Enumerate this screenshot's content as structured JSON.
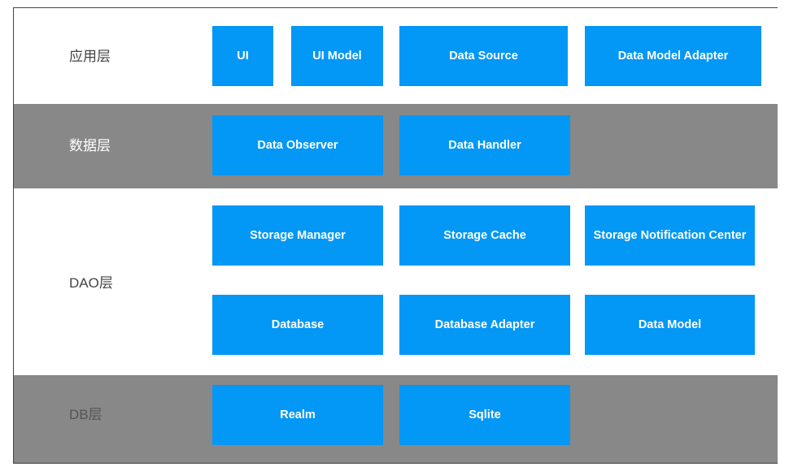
{
  "colors": {
    "box": "#0397f6",
    "gray_band": "#888888",
    "white_band": "#ffffff"
  },
  "layers": [
    {
      "label": "应用层",
      "boxes": [
        "UI",
        "UI Model",
        "Data Source",
        "Data Model Adapter"
      ]
    },
    {
      "label": "数据层",
      "boxes": [
        "Data Observer",
        "Data Handler"
      ]
    },
    {
      "label": "DAO层",
      "boxes": [
        "Storage Manager",
        "Storage Cache",
        "Storage Notification Center",
        "Database",
        "Database Adapter",
        "Data Model"
      ]
    },
    {
      "label": "DB层",
      "boxes": [
        "Realm",
        "Sqlite"
      ]
    }
  ]
}
